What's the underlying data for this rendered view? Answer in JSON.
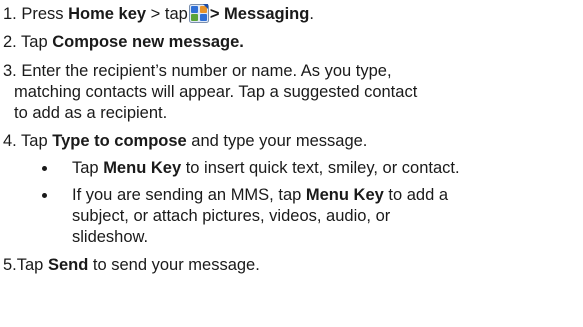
{
  "steps": {
    "s1": {
      "prefix": "1. Press ",
      "bold1": "Home key",
      "mid": " > tap",
      "icon": "applications-grid-icon",
      "bold2": "> Messaging",
      "suffix": "."
    },
    "s2": {
      "prefix": "2. Tap ",
      "bold": "Compose new message."
    },
    "s3": {
      "line1": "3. Enter the recipient’s number or name. As you type,",
      "line2": "matching contacts will appear. Tap a suggested contact",
      "line3": "to add as a recipient."
    },
    "s4": {
      "prefix": "4. Tap ",
      "bold": "Type to compose",
      "suffix": " and type your message."
    },
    "bullets": [
      {
        "prefix": "Tap ",
        "bold": "Menu Key",
        "suffix": " to insert quick text, smiley, or contact."
      },
      {
        "line1_prefix": "If you are sending an MMS, tap ",
        "line1_bold": "Menu Key",
        "line1_suffix": " to add a",
        "line2": "subject, or attach pictures, videos, audio, or",
        "line3": "slideshow."
      }
    ],
    "s5": {
      "prefix": "5.Tap ",
      "bold": "Send",
      "suffix": " to send your message."
    }
  },
  "colors": {
    "text": "#1a1a1a",
    "icon_blue": "#2f6fd6",
    "icon_orange": "#e8932a",
    "icon_green": "#5aa33a"
  }
}
